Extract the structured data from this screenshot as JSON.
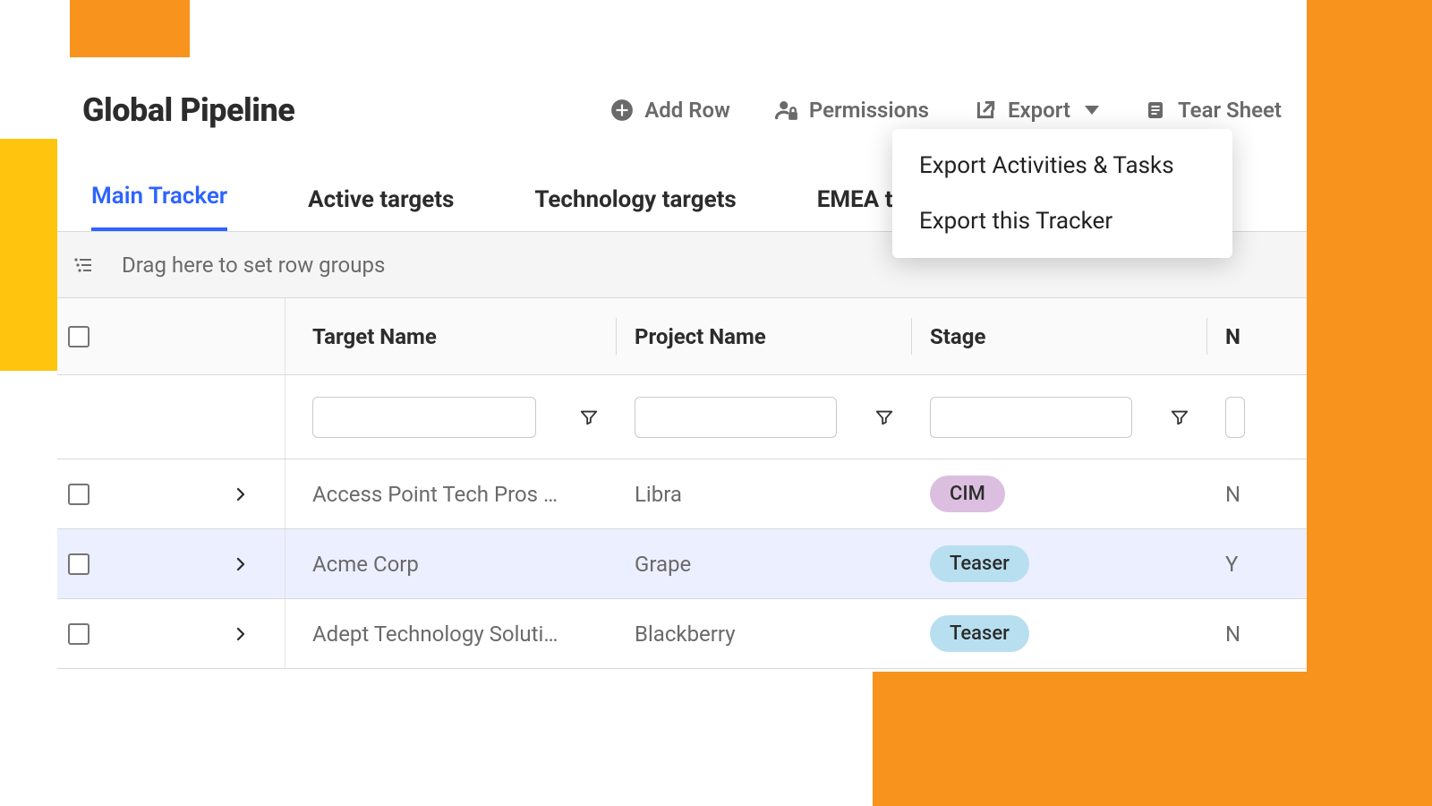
{
  "page_title": "Global Pipeline",
  "header": {
    "add_row": "Add Row",
    "permissions": "Permissions",
    "export": "Export",
    "tear_sheet": "Tear Sheet"
  },
  "tabs": [
    "Main Tracker",
    "Active targets",
    "Technology targets",
    "EMEA targets"
  ],
  "active_tab": 0,
  "group_hint": "Drag here to set row groups",
  "columns": {
    "target_name": "Target Name",
    "project_name": "Project Name",
    "stage": "Stage",
    "next": "N"
  },
  "stage_labels": {
    "cim": "CIM",
    "teaser": "Teaser"
  },
  "rows": [
    {
      "target": "Access Point Tech Pros …",
      "project": "Libra",
      "stage": "cim",
      "last": "N",
      "selected": false
    },
    {
      "target": "Acme Corp",
      "project": "Grape",
      "stage": "teaser",
      "last": "Y",
      "selected": true
    },
    {
      "target": "Adept Technology Soluti…",
      "project": "Blackberry",
      "stage": "teaser",
      "last": "N",
      "selected": false
    }
  ],
  "export_menu": {
    "activities": "Export Activities & Tasks",
    "tracker": "Export this Tracker"
  }
}
